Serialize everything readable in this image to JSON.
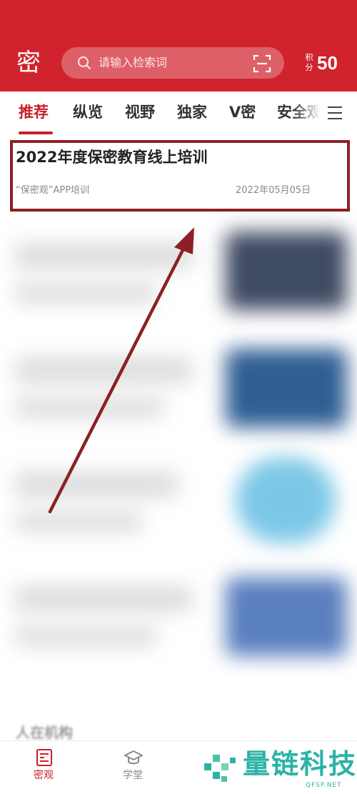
{
  "header": {
    "logo_glyph": "密",
    "search_placeholder": "请输入检索词",
    "points_label": "积分",
    "points_value": "50"
  },
  "tabs": [
    {
      "label": "推荐",
      "active": true
    },
    {
      "label": "纵览"
    },
    {
      "label": "视野"
    },
    {
      "label": "独家"
    },
    {
      "label": "V密"
    },
    {
      "label": "安全观"
    }
  ],
  "featured_article": {
    "title": "2022年度保密教育线上培训",
    "source": "“保密观”APP培训",
    "date": "2022年05月05日"
  },
  "feed": {
    "section_heading": "人在机构"
  },
  "bottom_nav": [
    {
      "label": "密观",
      "active": true
    },
    {
      "label": "学堂"
    }
  ],
  "watermark": {
    "text": "量链科技",
    "sub": "QFSP.NET"
  },
  "colors": {
    "brand_red": "#d0232e",
    "annotation_red": "#8c2026",
    "watermark_teal": "#2bb3a6"
  }
}
